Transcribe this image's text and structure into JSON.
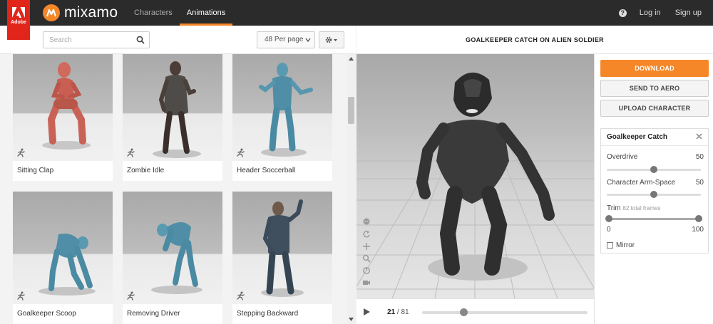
{
  "brand": {
    "adobe_label": "Adobe",
    "name": "mixamo"
  },
  "nav": {
    "tabs": [
      {
        "label": "Characters"
      },
      {
        "label": "Animations"
      }
    ],
    "active_tab": "Animations",
    "login": "Log in",
    "signup": "Sign up"
  },
  "toolbar": {
    "search_placeholder": "Search",
    "per_page": "48 Per page"
  },
  "animations": [
    {
      "name": "Sitting Clap"
    },
    {
      "name": "Zombie Idle"
    },
    {
      "name": "Header Soccerball"
    },
    {
      "name": "Goalkeeper Scoop"
    },
    {
      "name": "Removing Driver"
    },
    {
      "name": "Stepping Backward"
    }
  ],
  "viewer": {
    "title": "GOALKEEPER CATCH ON ALIEN SOLDIER",
    "current_frame": "21",
    "total_frames": "/ 81",
    "playback_progress": 0.25
  },
  "actions": {
    "download": "DOWNLOAD",
    "send_to_aero": "SEND TO AERO",
    "upload": "UPLOAD CHARACTER"
  },
  "settings": {
    "title": "Goalkeeper Catch",
    "overdrive": {
      "label": "Overdrive",
      "value": "50"
    },
    "arm_space": {
      "label": "Character Arm-Space",
      "value": "50"
    },
    "trim": {
      "label": "Trim",
      "subtitle": "82 total frames",
      "min": "0",
      "max": "100"
    },
    "mirror": {
      "label": "Mirror",
      "checked": false
    }
  },
  "colors": {
    "accent": "#f68728",
    "adobe_red": "#e1251b",
    "topbar": "#2b2b2b"
  }
}
